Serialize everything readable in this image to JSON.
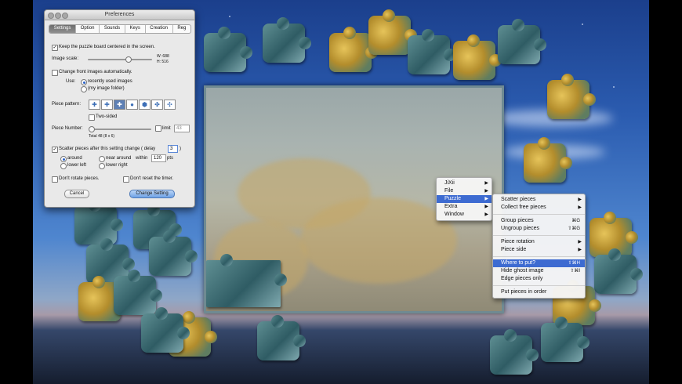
{
  "preferences": {
    "title": "Preferences",
    "tabs": [
      "Settings",
      "Option",
      "Sounds",
      "Keys",
      "Creation",
      "Reg"
    ],
    "keep_centered_label": "Keep the puzzle board centered in the screen.",
    "image_scale_label": "Image scale:",
    "image_scale_value": 0.63,
    "image_w": "W: 688",
    "image_h": "H: 516",
    "change_images_label": "Change front images automatically.",
    "use_label": "Use:",
    "recent_images_label": "recently used images",
    "my_folder_label": "(my image folder)",
    "piece_pattern_label": "Piece pattern:",
    "two_sided_label": "Two-sided",
    "piece_number_label": "Piece Number:",
    "piece_number_value": 0.05,
    "limit_label": "limit",
    "limit_value": "43",
    "total_label": "Total 48 (8 x 6)",
    "scatter_label": "Scatter pieces after this setting change  ( delay",
    "scatter_delay": "3",
    "scatter_close": ")",
    "around_label": "around",
    "near_around_label": "near around",
    "within_label": "within",
    "within_value": "120",
    "pts_label": "pts",
    "lower_left_label": "lower left",
    "lower_right_label": "lower right",
    "dont_rotate_label": "Don't rotate pieces.",
    "dont_reset_label": "Don't reset the timer.",
    "cancel_label": "Cancel",
    "change_setting_label": "Change Setting"
  },
  "main_menu": {
    "items": [
      {
        "label": "JiXii",
        "submenu": true
      },
      {
        "label": "File",
        "submenu": true
      },
      {
        "label": "Puzzle",
        "submenu": true,
        "highlighted": true
      },
      {
        "label": "Extra",
        "submenu": true
      },
      {
        "label": "Window",
        "submenu": true
      }
    ]
  },
  "puzzle_menu": {
    "scatter_pieces": "Scatter pieces",
    "collect_free_pieces": "Collect free pieces",
    "group_pieces": "Group pieces",
    "group_shortcut": "⌘G",
    "ungroup_pieces": "Ungroup pieces",
    "ungroup_shortcut": "⇧⌘G",
    "piece_rotation": "Piece rotation",
    "piece_side": "Piece side",
    "where_to_put": "Where to put?",
    "where_shortcut": "⇧⌘H",
    "hide_ghost": "Hide ghost image",
    "hide_ghost_shortcut": "⇧⌘I",
    "edge_pieces_only": "Edge pieces only",
    "put_in_order": "Put pieces in order"
  },
  "colors": {
    "menu_highlight": "#3d6bd1",
    "default_button": "#6ea2e6"
  }
}
